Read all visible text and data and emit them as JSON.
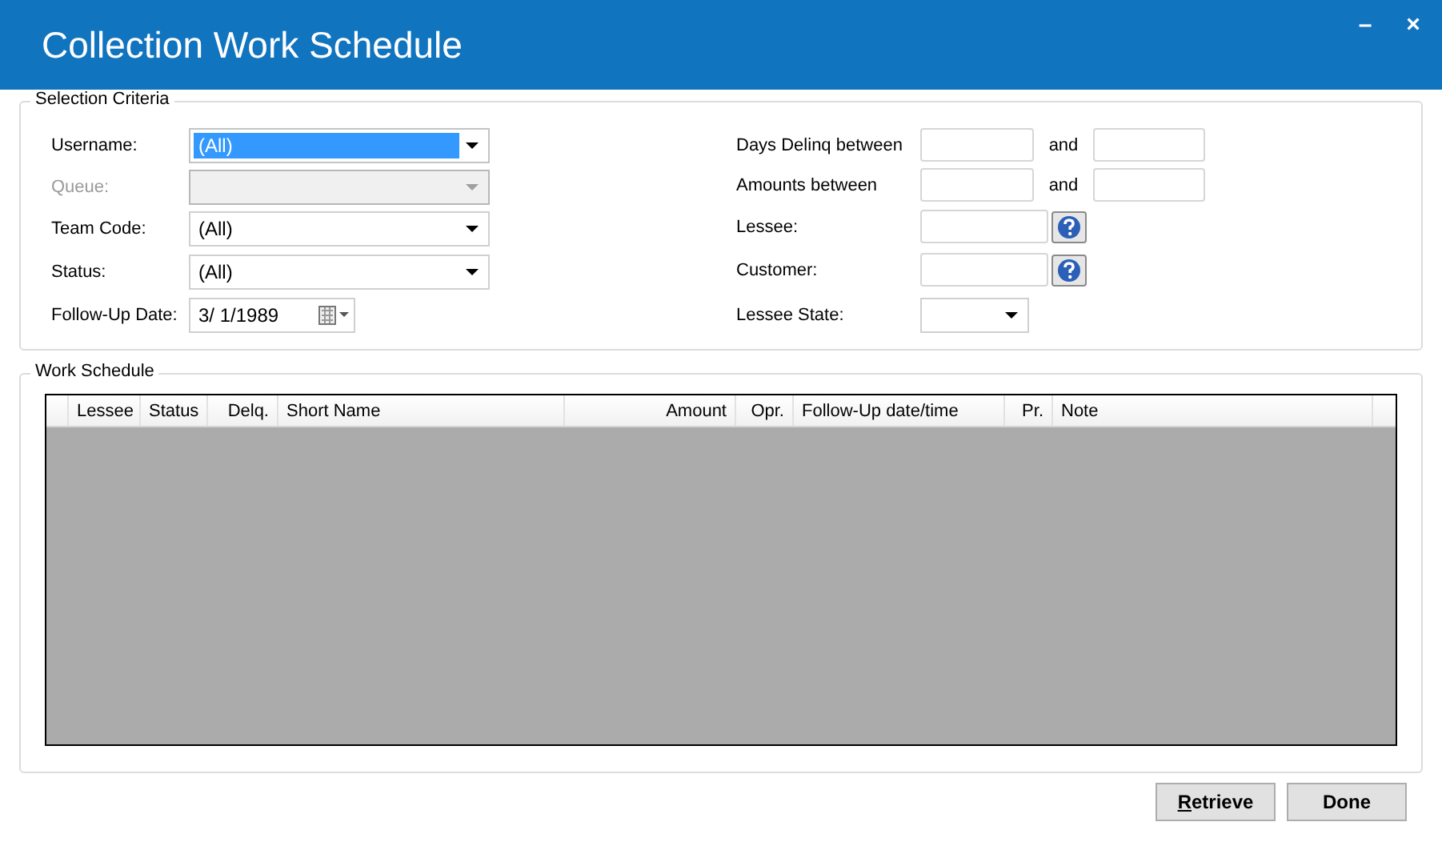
{
  "window": {
    "title": "Collection Work Schedule",
    "controls": [
      "–",
      "×"
    ]
  },
  "selection_criteria": {
    "title": "Selection Criteria",
    "left_fields": [
      {
        "kind": "combo",
        "label": "Username:",
        "value": "(All)",
        "disabled": false,
        "highlighted": true
      },
      {
        "kind": "combo",
        "label": "Queue:",
        "disabled": true,
        "highlighted": false
      },
      {
        "kind": "combo",
        "label": "Team Code:",
        "value": "(All)",
        "disabled": false,
        "highlighted": false
      },
      {
        "kind": "combo",
        "label": "Status:",
        "value": "(All)",
        "disabled": false,
        "highlighted": false
      },
      {
        "kind": "date",
        "label": "Follow-Up Date:",
        "value": "3/  1/1989",
        "disabled": false
      }
    ],
    "right_fields": [
      {
        "kind": "range",
        "label": "Days Delinq between",
        "joiner": "and"
      },
      {
        "kind": "range",
        "label": "Amounts between",
        "joiner": "and"
      },
      {
        "kind": "lookup",
        "label": "Lessee:"
      },
      {
        "kind": "lookup",
        "label": "Customer:"
      },
      {
        "kind": "combo",
        "label": "Lessee State:"
      }
    ]
  },
  "work_schedule": {
    "title": "Work Schedule",
    "columns": [
      "Lessee",
      "Status",
      "Delq.",
      "Short Name",
      "Amount",
      "Opr.",
      "Follow-Up date/time",
      "Pr.",
      "Note"
    ]
  },
  "buttons": [
    {
      "label": "Retrieve",
      "underline_first": true
    },
    {
      "label": "Done",
      "underline_first": false
    }
  ]
}
